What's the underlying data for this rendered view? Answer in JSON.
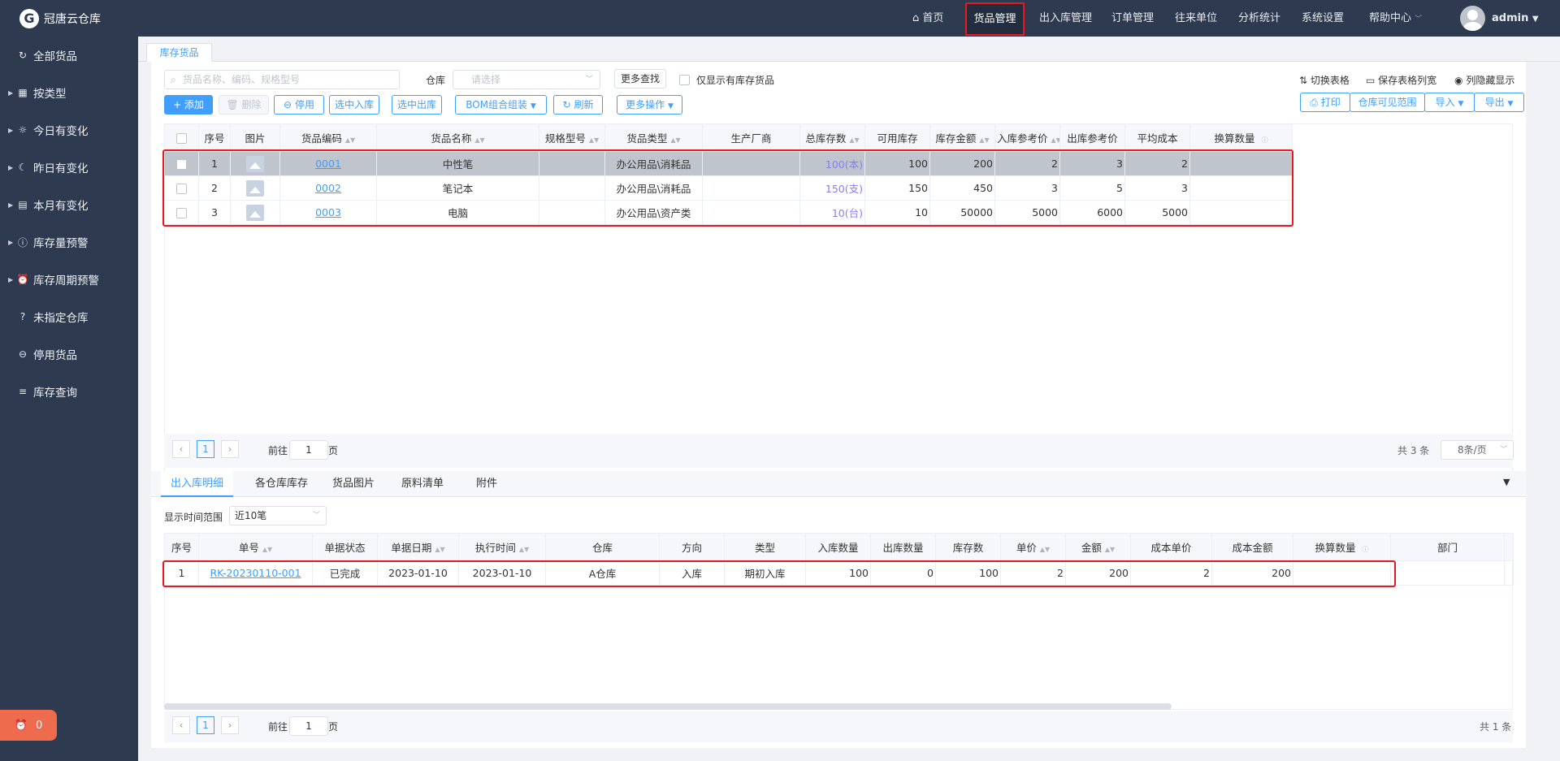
{
  "app": {
    "logo_text": "冠唐云仓库",
    "logo_letter": "G"
  },
  "sidebar": {
    "items": [
      {
        "label": "全部货品",
        "icon": "↻",
        "caret": ""
      },
      {
        "label": "按类型",
        "icon": "▦",
        "caret": "▶"
      },
      {
        "label": "今日有变化",
        "icon": "☼",
        "caret": "▶"
      },
      {
        "label": "昨日有变化",
        "icon": "☾",
        "caret": "▶"
      },
      {
        "label": "本月有变化",
        "icon": "▤",
        "caret": "▶"
      },
      {
        "label": "库存量预警",
        "icon": "ⓘ",
        "caret": "▶"
      },
      {
        "label": "库存周期预警",
        "icon": "⏰",
        "caret": "▶"
      },
      {
        "label": "未指定仓库",
        "icon": "?",
        "caret": ""
      },
      {
        "label": "停用货品",
        "icon": "⊖",
        "caret": ""
      },
      {
        "label": "库存查询",
        "icon": "≡",
        "caret": ""
      }
    ],
    "alert_count": "0"
  },
  "nav": {
    "home": "首页",
    "goods": "货品管理",
    "inout": "出入库管理",
    "orders": "订单管理",
    "partners": "往来单位",
    "analytics": "分析统计",
    "settings": "系统设置",
    "help": "帮助中心",
    "user": "admin"
  },
  "page_tab": "库存货品",
  "filters": {
    "search_placeholder": "货品名称、编码、规格型号",
    "warehouse_label": "仓库",
    "warehouse_placeholder": "请选择",
    "more_search": "更多查找",
    "only_stock_label": "仅显示有库存货品"
  },
  "right_tools": {
    "switch": "切换表格",
    "save_width": "保存表格列宽",
    "hide_cols": "列隐藏显示"
  },
  "toolbar": {
    "add": "+ 添加",
    "delete": "删除",
    "disable": "停用",
    "select_in": "选中入库",
    "select_out": "选中出库",
    "bom": "BOM组合组装",
    "refresh": "刷新",
    "more_ops": "更多操作",
    "print": "打印",
    "visible_range": "仓库可见范围",
    "import": "导入",
    "export": "导出"
  },
  "goods_table": {
    "headers": [
      "序号",
      "图片",
      "货品编码",
      "货品名称",
      "规格型号",
      "货品类型",
      "生产厂商",
      "总库存数",
      "可用库存",
      "库存金额",
      "入库参考价",
      "出库参考价",
      "平均成本",
      "换算数量"
    ],
    "rows": [
      {
        "idx": "1",
        "code": "0001",
        "name": "中性笔",
        "spec": "",
        "type": "办公用品\\消耗品",
        "maker": "",
        "total": "100(本)",
        "avail": "100",
        "amount": "200",
        "in_price": "2",
        "out_price": "3",
        "avg_cost": "2",
        "conv": ""
      },
      {
        "idx": "2",
        "code": "0002",
        "name": "笔记本",
        "spec": "",
        "type": "办公用品\\消耗品",
        "maker": "",
        "total": "150(支)",
        "avail": "150",
        "amount": "450",
        "in_price": "3",
        "out_price": "5",
        "avg_cost": "3",
        "conv": ""
      },
      {
        "idx": "3",
        "code": "0003",
        "name": "电脑",
        "spec": "",
        "type": "办公用品\\资产类",
        "maker": "",
        "total": "10(台)",
        "avail": "10",
        "amount": "50000",
        "in_price": "5000",
        "out_price": "6000",
        "avg_cost": "5000",
        "conv": ""
      }
    ]
  },
  "pager1": {
    "prev_label": "前往",
    "page": "1",
    "page_suffix": "页",
    "total": "共 3 条",
    "page_size": "8条/页",
    "current": "1"
  },
  "sub_tabs": [
    "出入库明细",
    "各仓库库存",
    "货品图片",
    "原料清单",
    "附件"
  ],
  "detail_filter": {
    "label": "显示时间范围",
    "value": "近10笔"
  },
  "detail_table": {
    "headers": [
      "序号",
      "单号",
      "单据状态",
      "单据日期",
      "执行时间",
      "仓库",
      "方向",
      "类型",
      "入库数量",
      "出库数量",
      "库存数",
      "单价",
      "金额",
      "成本单价",
      "成本金额",
      "换算数量",
      "部门"
    ],
    "rows": [
      {
        "idx": "1",
        "no": "RK-20230110-001",
        "status": "已完成",
        "date": "2023-01-10",
        "exec": "2023-01-10",
        "wh": "A仓库",
        "dir": "入库",
        "type": "期初入库",
        "in_qty": "100",
        "out_qty": "0",
        "stock": "100",
        "price": "2",
        "amount": "200",
        "cost_price": "2",
        "cost_amount": "200",
        "conv": "",
        "dept": ""
      }
    ]
  },
  "pager2": {
    "prev_label": "前往",
    "page": "1",
    "page_suffix": "页",
    "total": "共 1 条",
    "current": "1"
  }
}
